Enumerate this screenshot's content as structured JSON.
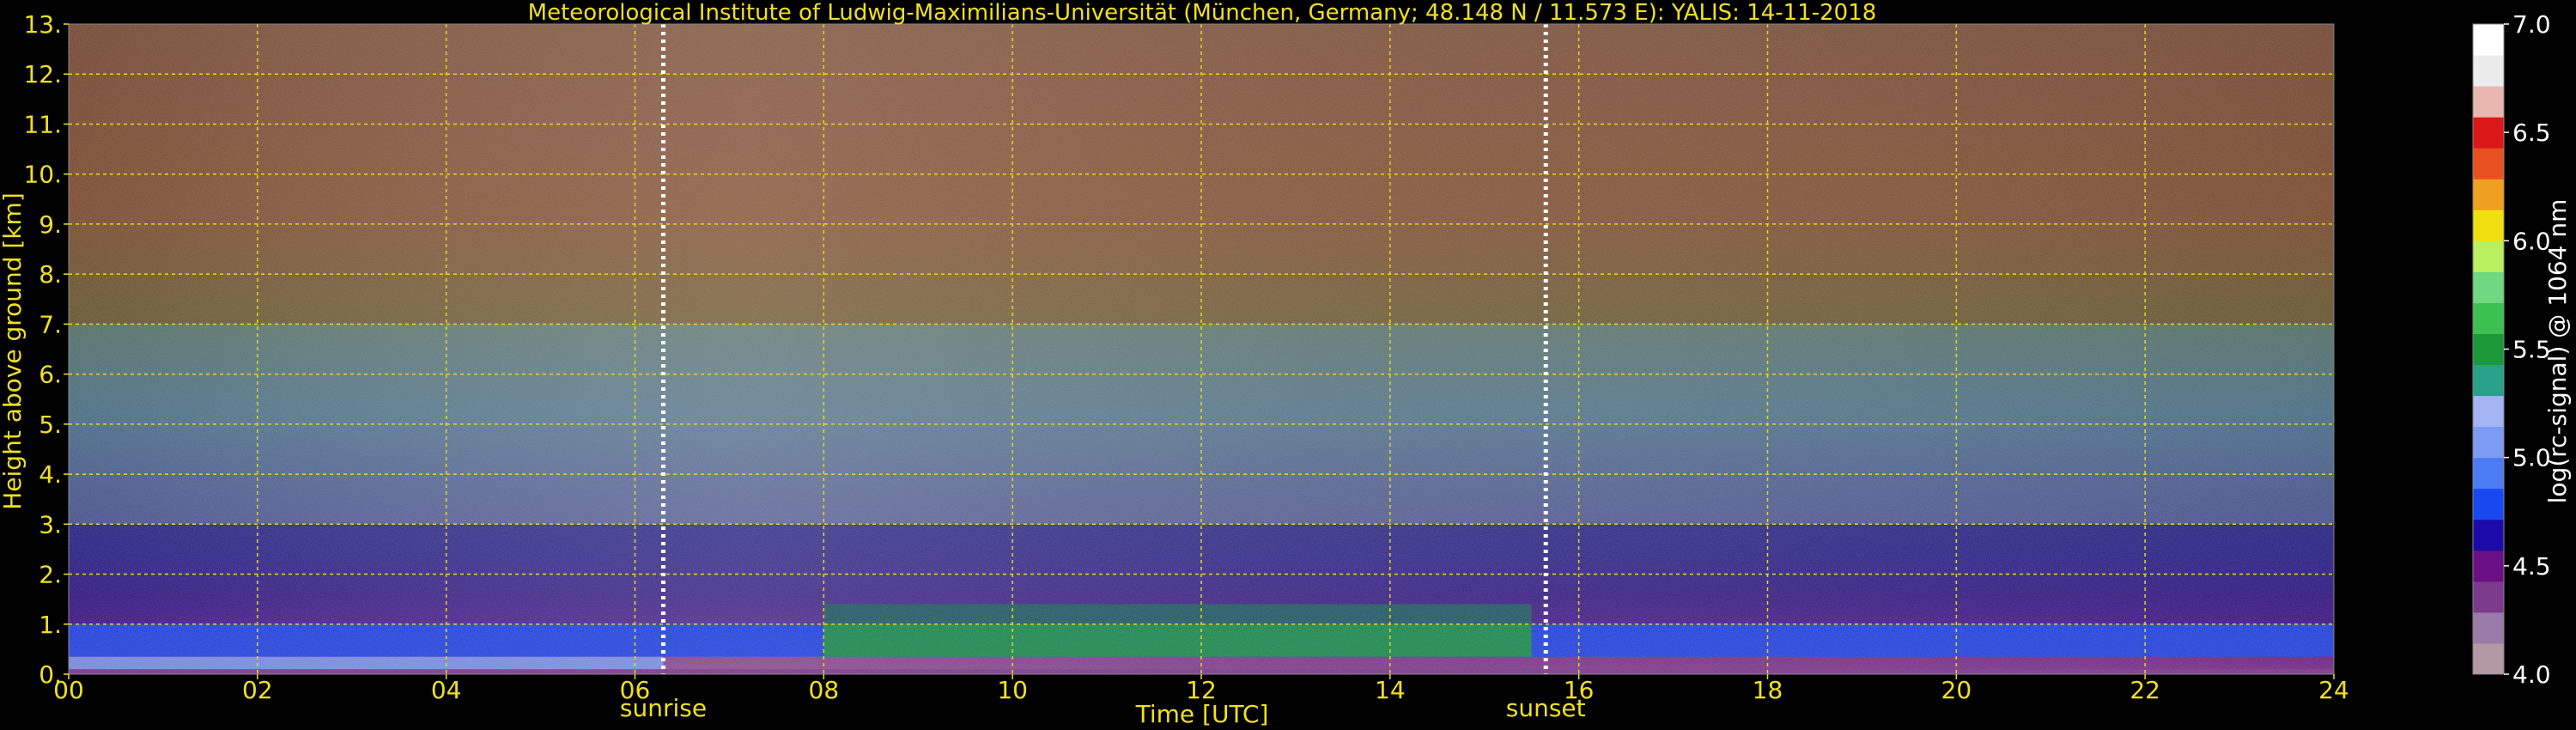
{
  "chart_data": {
    "type": "heatmap",
    "title": "Meteorological Institute of Ludwig-Maximilians-Universität (München, Germany; 48.148 N / 11.573 E):    YALIS: 14-11-2018",
    "xlabel": "Time [UTC]",
    "ylabel": "Height above ground [km]",
    "xlim": [
      0,
      24
    ],
    "ylim": [
      0,
      13
    ],
    "x_ticks": [
      0,
      2,
      4,
      6,
      8,
      10,
      12,
      14,
      16,
      18,
      20,
      22,
      24
    ],
    "x_tick_labels": [
      "00",
      "02",
      "04",
      "06",
      "08",
      "10",
      "12",
      "14",
      "16",
      "18",
      "20",
      "22",
      "24"
    ],
    "y_ticks": [
      0,
      1,
      2,
      3,
      4,
      5,
      6,
      7,
      8,
      9,
      10,
      11,
      12,
      13
    ],
    "y_tick_labels": [
      "0.",
      "1.",
      "2.",
      "3.",
      "4.",
      "5.",
      "6.",
      "7.",
      "8.",
      "9.",
      "10.",
      "11.",
      "12.",
      "13."
    ],
    "grid": true,
    "markers": [
      {
        "time": 6.3,
        "label": "sunrise"
      },
      {
        "time": 15.65,
        "label": "sunset"
      }
    ],
    "colorbar": {
      "label": "log(rc-signal) @ 1064 nm",
      "range": [
        4.0,
        7.0
      ],
      "ticks": [
        4.0,
        4.5,
        5.0,
        5.5,
        6.0,
        6.5,
        7.0
      ],
      "tick_labels": [
        "4.0",
        "4.5",
        "5.0",
        "5.5",
        "6.0",
        "6.5",
        "7.0"
      ],
      "colors": [
        "#b39aa6",
        "#9a7aa8",
        "#7c3a8c",
        "#6a0f84",
        "#1c0aa8",
        "#1848f0",
        "#4c7cf4",
        "#7c9cf4",
        "#a4b4f4",
        "#28a08a",
        "#1c9838",
        "#3cc050",
        "#70d880",
        "#b8f060",
        "#f0e010",
        "#f0a020",
        "#e85020",
        "#dc1818",
        "#e8b8b0",
        "#ececec",
        "#ffffff"
      ]
    },
    "layers": [
      {
        "height_range_km": [
          0.0,
          0.1
        ],
        "time_range_h": [
          0,
          24
        ],
        "value_log": 4.3
      },
      {
        "height_range_km": [
          0.1,
          0.35
        ],
        "time_range_h": [
          0,
          6.3
        ],
        "value_log": 5.1
      },
      {
        "height_range_km": [
          0.35,
          1.0
        ],
        "time_range_h": [
          0,
          24
        ],
        "value_log": 4.8
      },
      {
        "height_range_km": [
          0.35,
          1.4
        ],
        "time_range_h": [
          8.0,
          15.5
        ],
        "value_log": 5.5
      },
      {
        "height_range_km": [
          1.0,
          3.0
        ],
        "time_range_h": [
          0,
          24
        ],
        "value_log": 4.6
      },
      {
        "height_range_km": [
          3.0,
          7.0
        ],
        "time_range_h": [
          0,
          24
        ],
        "value_log": 5.2
      },
      {
        "height_range_km": [
          7.0,
          13.0
        ],
        "time_range_h": [
          0,
          24
        ],
        "value_log": 6.3
      }
    ]
  }
}
